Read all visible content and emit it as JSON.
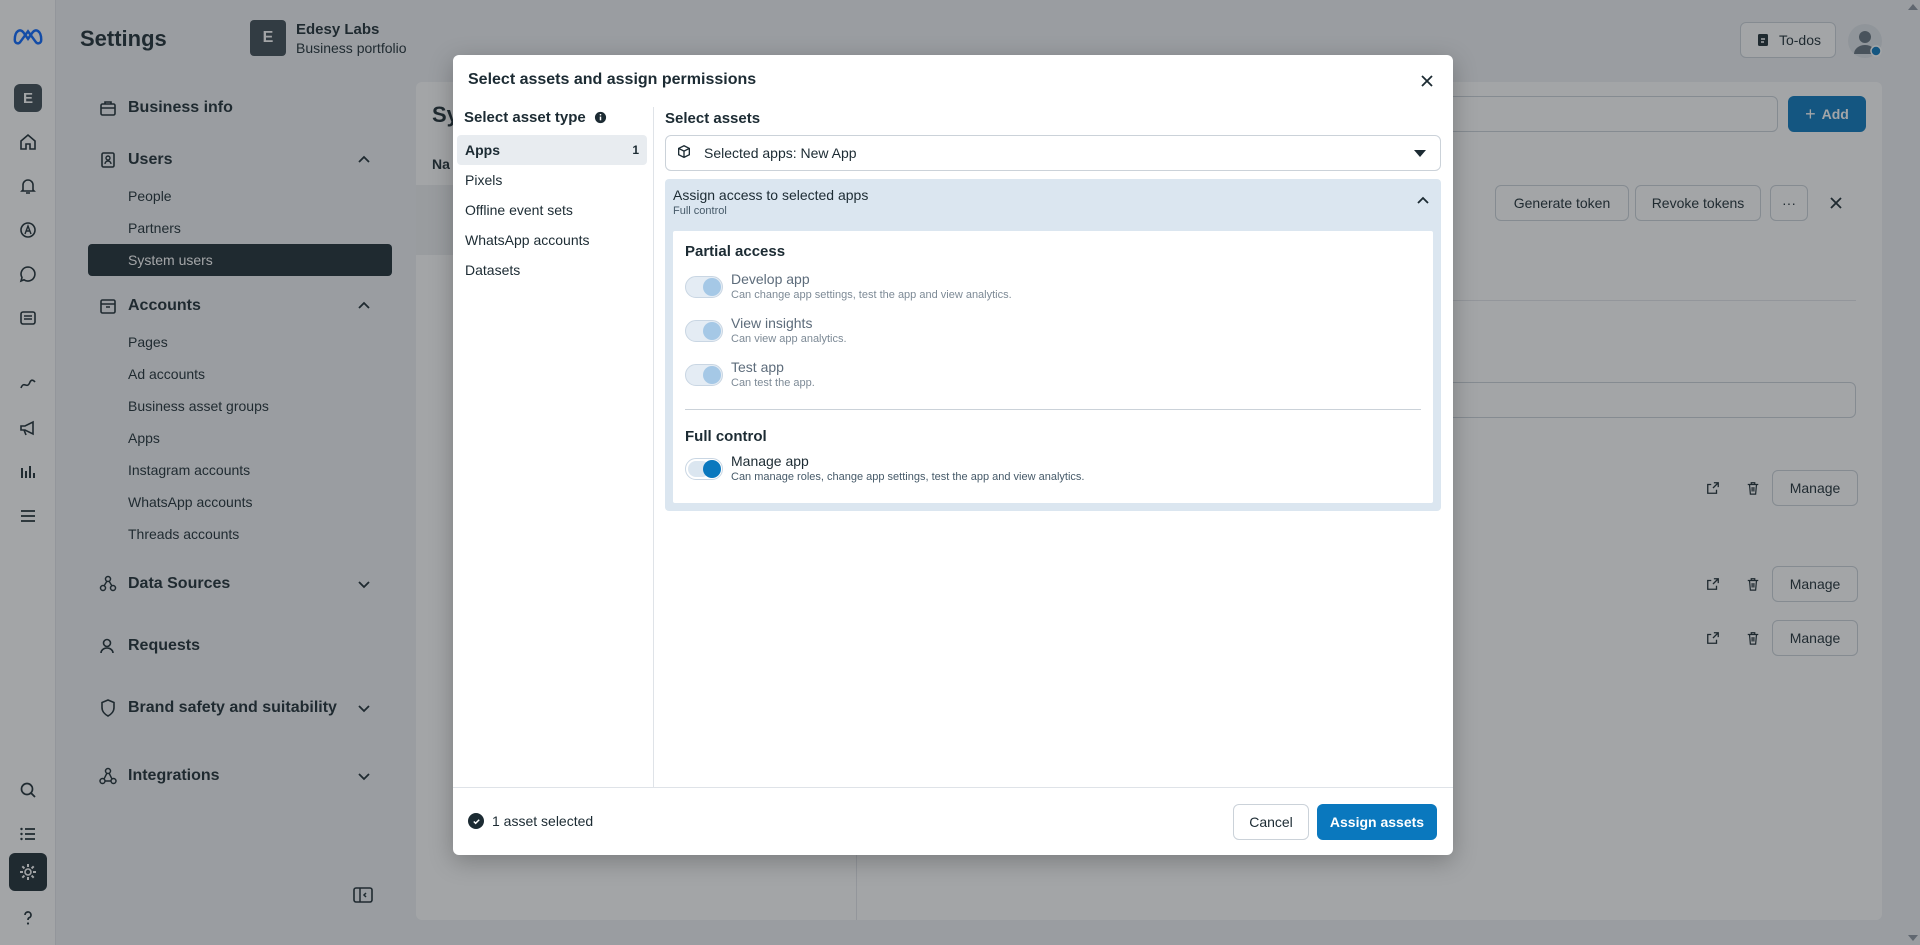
{
  "header": {
    "title": "Settings",
    "portfolio_initial": "E",
    "portfolio_name": "Edesy Labs",
    "portfolio_sub": "Business portfolio",
    "todos_label": "To-dos"
  },
  "rail": {
    "account_initial": "E"
  },
  "nav": {
    "business_info": "Business info",
    "users": {
      "label": "Users",
      "items": [
        "People",
        "Partners",
        "System users"
      ]
    },
    "accounts": {
      "label": "Accounts",
      "items": [
        "Pages",
        "Ad accounts",
        "Business asset groups",
        "Apps",
        "Instagram accounts",
        "WhatsApp accounts",
        "Threads accounts"
      ]
    },
    "data_sources": "Data Sources",
    "requests": "Requests",
    "brand_safety": "Brand safety and suitability",
    "integrations": "Integrations"
  },
  "background": {
    "title_fragment": "Sy",
    "col_fragment": "Na",
    "add_label": "Add",
    "generate_token": "Generate token",
    "revoke_tokens": "Revoke tokens",
    "more": "···",
    "manage_label": "Manage"
  },
  "modal": {
    "title": "Select assets and assign permissions",
    "asset_type_heading": "Select asset type",
    "asset_types": [
      {
        "label": "Apps",
        "count": "1"
      },
      {
        "label": "Pixels",
        "count": ""
      },
      {
        "label": "Offline event sets",
        "count": ""
      },
      {
        "label": "WhatsApp accounts",
        "count": ""
      },
      {
        "label": "Datasets",
        "count": ""
      }
    ],
    "select_assets_heading": "Select assets",
    "dropdown_value": "Selected apps: New App",
    "access": {
      "title": "Assign access to selected apps",
      "subtitle": "Full control",
      "partial_heading": "Partial access",
      "partial": [
        {
          "name": "Develop app",
          "desc": "Can change app settings, test the app and view analytics."
        },
        {
          "name": "View insights",
          "desc": "Can view app analytics."
        },
        {
          "name": "Test app",
          "desc": "Can test the app."
        }
      ],
      "full_heading": "Full control",
      "full": {
        "name": "Manage app",
        "desc": "Can manage roles, change app settings, test the app and view analytics."
      }
    },
    "footer_status": "1 asset selected",
    "cancel": "Cancel",
    "assign": "Assign assets"
  },
  "colors": {
    "primary": "#0a78be",
    "dark": "#1c2b33"
  }
}
